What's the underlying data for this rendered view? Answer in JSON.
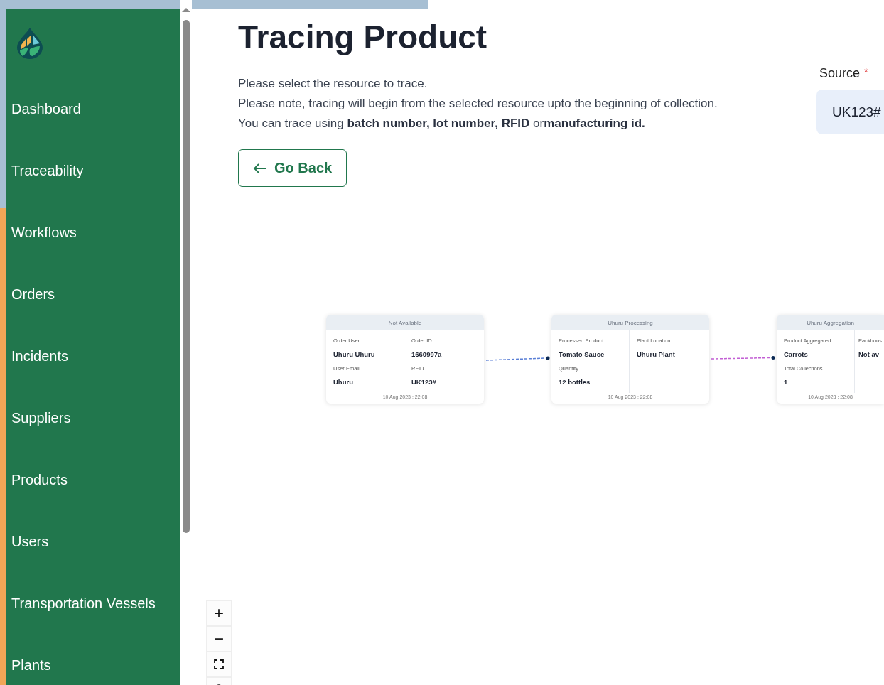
{
  "sidebar": {
    "items": [
      "Dashboard",
      "Traceability",
      "Workflows",
      "Orders",
      "Incidents",
      "Suppliers",
      "Products",
      "Users",
      "Transportation Vessels",
      "Plants"
    ]
  },
  "header": {
    "title": "Tracing Product",
    "intro": [
      "Please select the resource to trace.",
      "Please note, tracing will begin from the selected resource upto the beginning of collection.",
      "You can trace using **batch number, lot number, RFID** or**manufacturing id.**"
    ],
    "back_button": "Go Back"
  },
  "source": {
    "label": "Source",
    "required_mark": "*",
    "value": "UK123#"
  },
  "flow": {
    "nodes": [
      {
        "title": "Not Available",
        "left": [
          {
            "label": "Order User",
            "value": "Uhuru Uhuru"
          },
          {
            "label": "User Email",
            "value": "Uhuru"
          }
        ],
        "right": [
          {
            "label": "Order ID",
            "value": "1660997a"
          },
          {
            "label": "RFID",
            "value": "UK123#"
          }
        ],
        "timestamp": "10 Aug 2023 : 22:08"
      },
      {
        "title": "Uhuru Processing",
        "left": [
          {
            "label": "Processed Product",
            "value": "Tomato Sauce"
          },
          {
            "label": "Quantity",
            "value": "12 bottles"
          }
        ],
        "right": [
          {
            "label": "Plant Location",
            "value": "Uhuru Plant"
          }
        ],
        "timestamp": "10 Aug 2023 : 22:08"
      },
      {
        "title": "Uhuru Aggregation",
        "left": [
          {
            "label": "Product Aggregated",
            "value": "Carrots"
          },
          {
            "label": "Total Collections",
            "value": "1"
          }
        ],
        "right": [
          {
            "label": "Packhous",
            "value": "Not av"
          }
        ],
        "timestamp": "10 Aug 2023 : 22:08"
      }
    ],
    "edges": [
      {
        "color": "#5a7fd6"
      },
      {
        "color": "#c25fd4"
      }
    ],
    "zoom_controls": [
      "+",
      "−"
    ]
  }
}
